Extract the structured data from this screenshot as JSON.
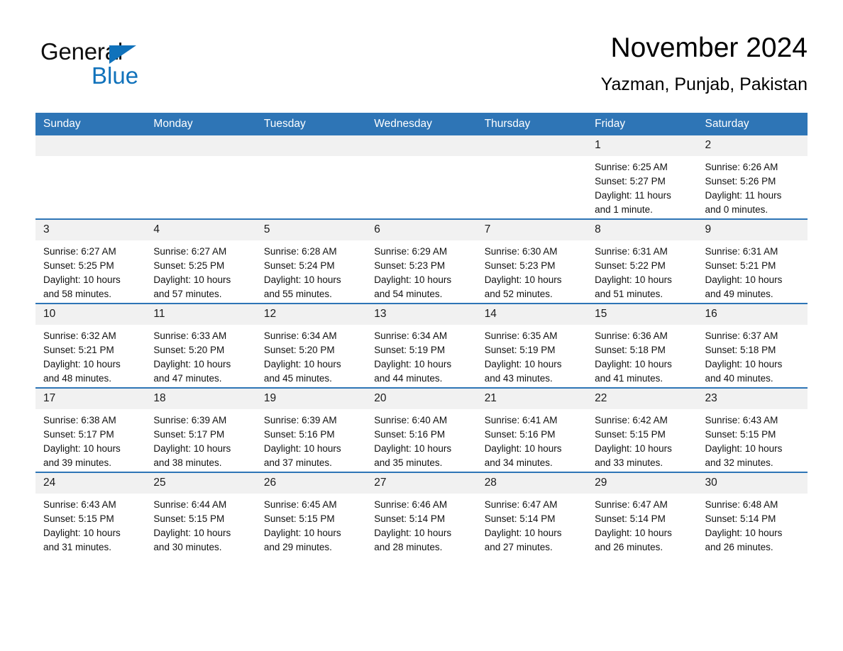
{
  "brand": {
    "name_part1": "General",
    "name_part2": "Blue",
    "triangle_color": "#1072bb"
  },
  "header": {
    "title": "November 2024",
    "subtitle": "Yazman, Punjab, Pakistan"
  },
  "theme": {
    "header_blue": "#2e75b6",
    "daynum_gray": "#f1f1f1",
    "row_rule": "#2e75b6"
  },
  "weekdays": [
    "Sunday",
    "Monday",
    "Tuesday",
    "Wednesday",
    "Thursday",
    "Friday",
    "Saturday"
  ],
  "labels": {
    "sunrise_prefix": "Sunrise:",
    "sunset_prefix": "Sunset:",
    "daylight_prefix": "Daylight:"
  },
  "weeks": [
    [
      {
        "day": "",
        "empty": true
      },
      {
        "day": "",
        "empty": true
      },
      {
        "day": "",
        "empty": true
      },
      {
        "day": "",
        "empty": true
      },
      {
        "day": "",
        "empty": true
      },
      {
        "day": "1",
        "sunrise": "Sunrise: 6:25 AM",
        "sunset": "Sunset: 5:27 PM",
        "daylight1": "Daylight: 11 hours",
        "daylight2": "and 1 minute."
      },
      {
        "day": "2",
        "sunrise": "Sunrise: 6:26 AM",
        "sunset": "Sunset: 5:26 PM",
        "daylight1": "Daylight: 11 hours",
        "daylight2": "and 0 minutes."
      }
    ],
    [
      {
        "day": "3",
        "sunrise": "Sunrise: 6:27 AM",
        "sunset": "Sunset: 5:25 PM",
        "daylight1": "Daylight: 10 hours",
        "daylight2": "and 58 minutes."
      },
      {
        "day": "4",
        "sunrise": "Sunrise: 6:27 AM",
        "sunset": "Sunset: 5:25 PM",
        "daylight1": "Daylight: 10 hours",
        "daylight2": "and 57 minutes."
      },
      {
        "day": "5",
        "sunrise": "Sunrise: 6:28 AM",
        "sunset": "Sunset: 5:24 PM",
        "daylight1": "Daylight: 10 hours",
        "daylight2": "and 55 minutes."
      },
      {
        "day": "6",
        "sunrise": "Sunrise: 6:29 AM",
        "sunset": "Sunset: 5:23 PM",
        "daylight1": "Daylight: 10 hours",
        "daylight2": "and 54 minutes."
      },
      {
        "day": "7",
        "sunrise": "Sunrise: 6:30 AM",
        "sunset": "Sunset: 5:23 PM",
        "daylight1": "Daylight: 10 hours",
        "daylight2": "and 52 minutes."
      },
      {
        "day": "8",
        "sunrise": "Sunrise: 6:31 AM",
        "sunset": "Sunset: 5:22 PM",
        "daylight1": "Daylight: 10 hours",
        "daylight2": "and 51 minutes."
      },
      {
        "day": "9",
        "sunrise": "Sunrise: 6:31 AM",
        "sunset": "Sunset: 5:21 PM",
        "daylight1": "Daylight: 10 hours",
        "daylight2": "and 49 minutes."
      }
    ],
    [
      {
        "day": "10",
        "sunrise": "Sunrise: 6:32 AM",
        "sunset": "Sunset: 5:21 PM",
        "daylight1": "Daylight: 10 hours",
        "daylight2": "and 48 minutes."
      },
      {
        "day": "11",
        "sunrise": "Sunrise: 6:33 AM",
        "sunset": "Sunset: 5:20 PM",
        "daylight1": "Daylight: 10 hours",
        "daylight2": "and 47 minutes."
      },
      {
        "day": "12",
        "sunrise": "Sunrise: 6:34 AM",
        "sunset": "Sunset: 5:20 PM",
        "daylight1": "Daylight: 10 hours",
        "daylight2": "and 45 minutes."
      },
      {
        "day": "13",
        "sunrise": "Sunrise: 6:34 AM",
        "sunset": "Sunset: 5:19 PM",
        "daylight1": "Daylight: 10 hours",
        "daylight2": "and 44 minutes."
      },
      {
        "day": "14",
        "sunrise": "Sunrise: 6:35 AM",
        "sunset": "Sunset: 5:19 PM",
        "daylight1": "Daylight: 10 hours",
        "daylight2": "and 43 minutes."
      },
      {
        "day": "15",
        "sunrise": "Sunrise: 6:36 AM",
        "sunset": "Sunset: 5:18 PM",
        "daylight1": "Daylight: 10 hours",
        "daylight2": "and 41 minutes."
      },
      {
        "day": "16",
        "sunrise": "Sunrise: 6:37 AM",
        "sunset": "Sunset: 5:18 PM",
        "daylight1": "Daylight: 10 hours",
        "daylight2": "and 40 minutes."
      }
    ],
    [
      {
        "day": "17",
        "sunrise": "Sunrise: 6:38 AM",
        "sunset": "Sunset: 5:17 PM",
        "daylight1": "Daylight: 10 hours",
        "daylight2": "and 39 minutes."
      },
      {
        "day": "18",
        "sunrise": "Sunrise: 6:39 AM",
        "sunset": "Sunset: 5:17 PM",
        "daylight1": "Daylight: 10 hours",
        "daylight2": "and 38 minutes."
      },
      {
        "day": "19",
        "sunrise": "Sunrise: 6:39 AM",
        "sunset": "Sunset: 5:16 PM",
        "daylight1": "Daylight: 10 hours",
        "daylight2": "and 37 minutes."
      },
      {
        "day": "20",
        "sunrise": "Sunrise: 6:40 AM",
        "sunset": "Sunset: 5:16 PM",
        "daylight1": "Daylight: 10 hours",
        "daylight2": "and 35 minutes."
      },
      {
        "day": "21",
        "sunrise": "Sunrise: 6:41 AM",
        "sunset": "Sunset: 5:16 PM",
        "daylight1": "Daylight: 10 hours",
        "daylight2": "and 34 minutes."
      },
      {
        "day": "22",
        "sunrise": "Sunrise: 6:42 AM",
        "sunset": "Sunset: 5:15 PM",
        "daylight1": "Daylight: 10 hours",
        "daylight2": "and 33 minutes."
      },
      {
        "day": "23",
        "sunrise": "Sunrise: 6:43 AM",
        "sunset": "Sunset: 5:15 PM",
        "daylight1": "Daylight: 10 hours",
        "daylight2": "and 32 minutes."
      }
    ],
    [
      {
        "day": "24",
        "sunrise": "Sunrise: 6:43 AM",
        "sunset": "Sunset: 5:15 PM",
        "daylight1": "Daylight: 10 hours",
        "daylight2": "and 31 minutes."
      },
      {
        "day": "25",
        "sunrise": "Sunrise: 6:44 AM",
        "sunset": "Sunset: 5:15 PM",
        "daylight1": "Daylight: 10 hours",
        "daylight2": "and 30 minutes."
      },
      {
        "day": "26",
        "sunrise": "Sunrise: 6:45 AM",
        "sunset": "Sunset: 5:15 PM",
        "daylight1": "Daylight: 10 hours",
        "daylight2": "and 29 minutes."
      },
      {
        "day": "27",
        "sunrise": "Sunrise: 6:46 AM",
        "sunset": "Sunset: 5:14 PM",
        "daylight1": "Daylight: 10 hours",
        "daylight2": "and 28 minutes."
      },
      {
        "day": "28",
        "sunrise": "Sunrise: 6:47 AM",
        "sunset": "Sunset: 5:14 PM",
        "daylight1": "Daylight: 10 hours",
        "daylight2": "and 27 minutes."
      },
      {
        "day": "29",
        "sunrise": "Sunrise: 6:47 AM",
        "sunset": "Sunset: 5:14 PM",
        "daylight1": "Daylight: 10 hours",
        "daylight2": "and 26 minutes."
      },
      {
        "day": "30",
        "sunrise": "Sunrise: 6:48 AM",
        "sunset": "Sunset: 5:14 PM",
        "daylight1": "Daylight: 10 hours",
        "daylight2": "and 26 minutes."
      }
    ]
  ]
}
